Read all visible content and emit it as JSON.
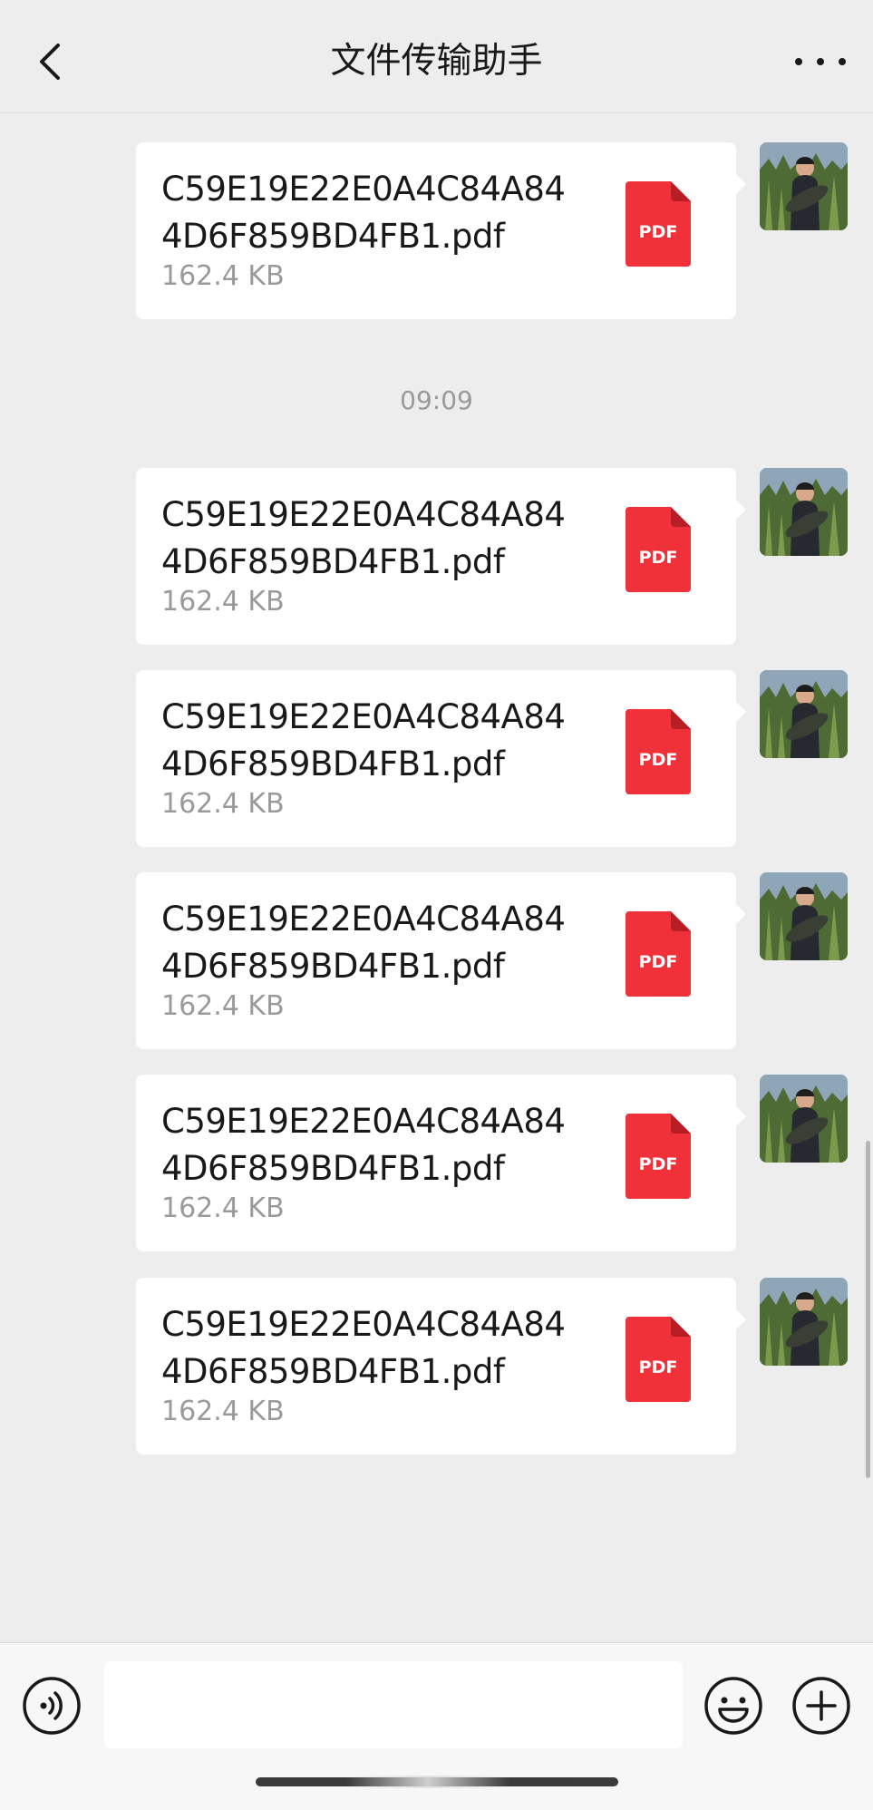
{
  "header": {
    "title": "文件传输助手",
    "back_icon": "chevron-left-icon",
    "more_icon": "more-horizontal-icon"
  },
  "timestamp": "09:09",
  "messages": [
    {
      "file_name": "C59E19E22E0A4C84A844D6F859BD4FB1.pdf",
      "file_size": "162.4 KB",
      "icon_label": "PDF"
    },
    {
      "file_name": "C59E19E22E0A4C84A844D6F859BD4FB1.pdf",
      "file_size": "162.4 KB",
      "icon_label": "PDF"
    },
    {
      "file_name": "C59E19E22E0A4C84A844D6F859BD4FB1.pdf",
      "file_size": "162.4 KB",
      "icon_label": "PDF"
    },
    {
      "file_name": "C59E19E22E0A4C84A844D6F859BD4FB1.pdf",
      "file_size": "162.4 KB",
      "icon_label": "PDF"
    },
    {
      "file_name": "C59E19E22E0A4C84A844D6F859BD4FB1.pdf",
      "file_size": "162.4 KB",
      "icon_label": "PDF"
    },
    {
      "file_name": "C59E19E22E0A4C84A844D6F859BD4FB1.pdf",
      "file_size": "162.4 KB",
      "icon_label": "PDF"
    }
  ],
  "input_bar": {
    "voice_icon": "voice-icon",
    "emoji_icon": "emoji-icon",
    "plus_icon": "plus-icon",
    "placeholder": ""
  },
  "colors": {
    "background": "#EDEDED",
    "bubble": "#FFFFFF",
    "pdf_red": "#F0313A",
    "secondary_text": "#9A9A9A"
  }
}
